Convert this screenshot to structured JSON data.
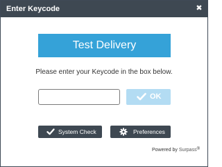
{
  "window": {
    "title": "Enter Keycode",
    "close_glyph": "✖"
  },
  "banner": {
    "text": "Test Delivery"
  },
  "instructions": "Please enter your Keycode in the box below.",
  "keycode": {
    "value": "",
    "placeholder": ""
  },
  "ok_button": {
    "label": "OK",
    "icon": "check-icon"
  },
  "system_check_button": {
    "label": "System Check",
    "icon": "check-icon"
  },
  "preferences_button": {
    "label": "Preferences",
    "icon": "gear-icon"
  },
  "footer": {
    "powered_by": "Powered by",
    "brand": "Surpass",
    "registered": "®"
  },
  "colors": {
    "titlebar": "#3e4852",
    "banner": "#35a2d8",
    "ok_disabled": "#b3dcf3",
    "dark_button": "#3e4852"
  }
}
